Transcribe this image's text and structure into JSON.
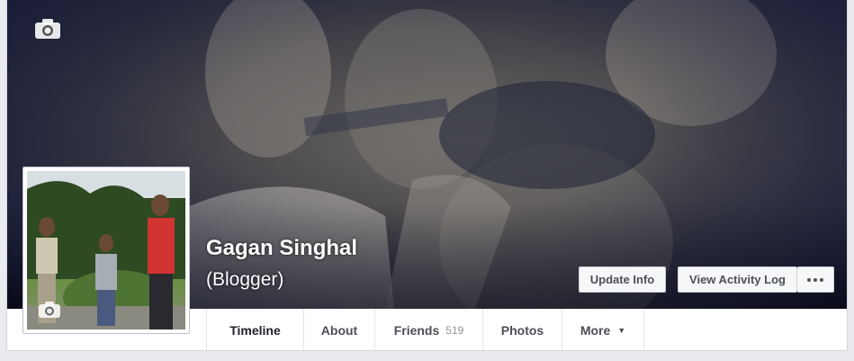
{
  "profile": {
    "name": "Gagan Singhal",
    "alternate_name": "(Blogger)"
  },
  "actions": {
    "update_info": "Update Info",
    "view_activity_log": "View Activity Log"
  },
  "tabs": [
    {
      "label": "Timeline",
      "active": true
    },
    {
      "label": "About"
    },
    {
      "label": "Friends",
      "count": "519"
    },
    {
      "label": "Photos"
    },
    {
      "label": "More"
    }
  ],
  "icons": {
    "cover_camera": "camera-icon",
    "profile_camera": "camera-icon",
    "more_actions": "more-dots-icon",
    "tab_more_caret": "caret-down-icon"
  },
  "colors": {
    "page_bg": "#e9ebee",
    "tab_text": "#4b4f56",
    "count_text": "#90949c"
  }
}
